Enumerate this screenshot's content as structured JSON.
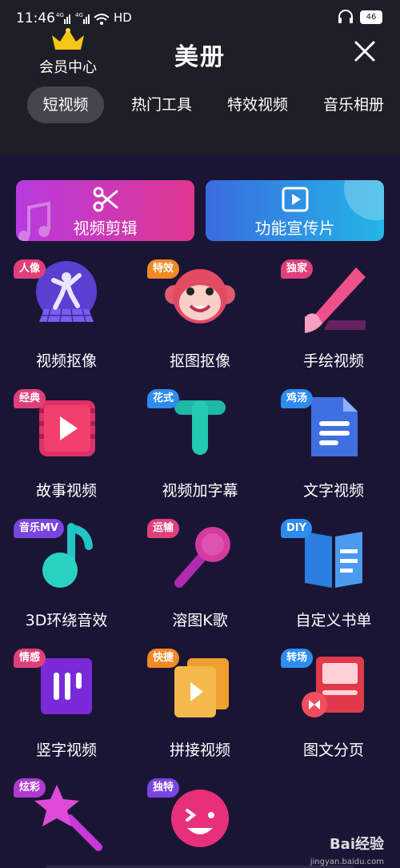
{
  "status": {
    "time": "11:46",
    "net": "4G",
    "hd": "HD",
    "battery": "46"
  },
  "header": {
    "vip_label": "会员中心",
    "title": "美册"
  },
  "tabs": [
    {
      "label": "短视频",
      "active": true
    },
    {
      "label": "热门工具",
      "active": false
    },
    {
      "label": "特效视频",
      "active": false
    },
    {
      "label": "音乐相册",
      "active": false
    }
  ],
  "banners": {
    "edit": "视频剪辑",
    "promo": "功能宣传片"
  },
  "tools": [
    {
      "label": "视频抠像",
      "badge": "人像",
      "icon": "dancer-icon"
    },
    {
      "label": "抠图抠像",
      "badge": "特效",
      "icon": "monkey-icon"
    },
    {
      "label": "手绘视频",
      "badge": "独家",
      "icon": "paintbrush-icon"
    },
    {
      "label": "故事视频",
      "badge": "经典",
      "icon": "film-play-icon"
    },
    {
      "label": "视频加字幕",
      "badge": "花式",
      "icon": "text-t-icon"
    },
    {
      "label": "文字视频",
      "badge": "鸡汤",
      "icon": "document-icon"
    },
    {
      "label": "3D环绕音效",
      "badge": "音乐MV",
      "icon": "music-note-icon"
    },
    {
      "label": "溶图K歌",
      "badge": "运输",
      "icon": "microphone-icon"
    },
    {
      "label": "自定义书单",
      "badge": "DIY",
      "icon": "book-icon"
    },
    {
      "label": "竖字视频",
      "badge": "情感",
      "icon": "vertical-bars-icon"
    },
    {
      "label": "拼接视频",
      "badge": "快捷",
      "icon": "stacked-play-icon"
    },
    {
      "label": "图文分页",
      "badge": "转场",
      "icon": "page-transition-icon"
    },
    {
      "label": "",
      "badge": "炫彩",
      "icon": "magic-wand-icon"
    },
    {
      "label": "",
      "badge": "独特",
      "icon": "smiley-icon"
    }
  ],
  "watermark": {
    "brand": "Bai经验",
    "sub": "jingyan.baidu.com"
  }
}
